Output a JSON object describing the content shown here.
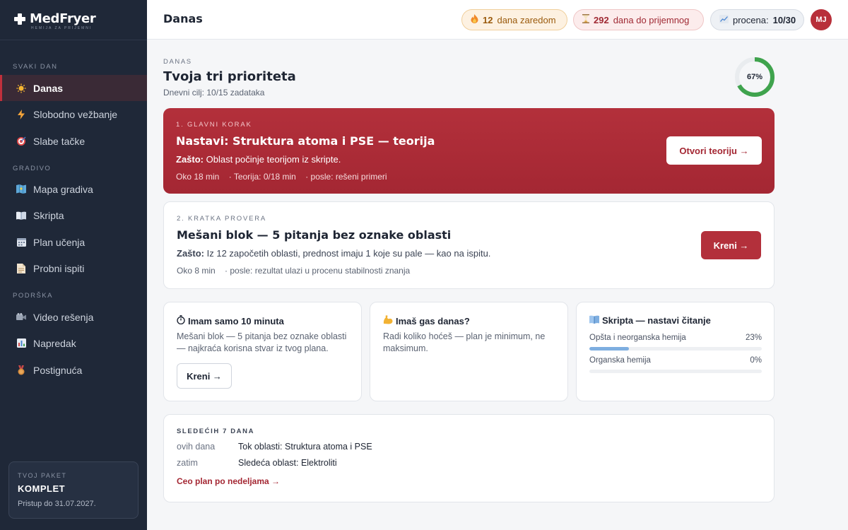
{
  "brand": {
    "name": "MedFryer",
    "tagline": "HEMIJA ZA PRIJEMNI"
  },
  "sidebar": {
    "sections": [
      {
        "label": "SVAKI DAN",
        "items": [
          {
            "label": "Danas",
            "icon": "sun-icon",
            "active": true
          },
          {
            "label": "Slobodno vežbanje",
            "icon": "lightning-icon"
          },
          {
            "label": "Slabe tačke",
            "icon": "target-icon"
          }
        ]
      },
      {
        "label": "GRADIVO",
        "items": [
          {
            "label": "Mapa gradiva",
            "icon": "map-icon"
          },
          {
            "label": "Skripta",
            "icon": "book-icon"
          },
          {
            "label": "Plan učenja",
            "icon": "calendar-icon"
          },
          {
            "label": "Probni ispiti",
            "icon": "document-icon"
          }
        ]
      },
      {
        "label": "PODRŠKA",
        "items": [
          {
            "label": "Video rešenja",
            "icon": "video-camera-icon"
          },
          {
            "label": "Napredak",
            "icon": "bar-chart-icon"
          },
          {
            "label": "Postignuća",
            "icon": "medal-icon"
          }
        ]
      }
    ],
    "plan": {
      "small_label": "TVOJ PAKET",
      "name": "KOMPLET",
      "access": "Pristup do 31.07.2027."
    }
  },
  "topbar": {
    "title": "Danas",
    "streak": {
      "value": "12",
      "label": "dana zaredom"
    },
    "days_left": {
      "value": "292",
      "label": "dana do prijemnog"
    },
    "estimate": {
      "label": "procena:",
      "value": "10/30"
    },
    "avatar": "MJ"
  },
  "main": {
    "kicker": "DANAS",
    "heading": "Tvoja tri prioriteta",
    "goal": "Dnevni cilj: 10/15 zadataka",
    "progress_percent": 67,
    "progress_label": "67%",
    "priority1": {
      "kicker": "1. GLAVNI KORAK",
      "title": "Nastavi: Struktura atoma i PSE — teorija",
      "why_label": "Zašto:",
      "why_text": "Oblast počinje teorijom iz skripte.",
      "meta": [
        "Oko 18 min",
        "· Teorija: 0/18 min",
        "· posle: rešeni primeri"
      ],
      "button": "Otvori teoriju →"
    },
    "priority2": {
      "kicker": "2. KRATKA PROVERA",
      "title": "Mešani blok — 5 pitanja bez oznake oblasti",
      "why_label": "Zašto:",
      "why_text": "Iz 12 započetih oblasti, prednost imaju 1 koje su pale — kao na ispitu.",
      "meta": [
        "Oko 8 min",
        "· posle: rezultat ulazi u procenu stabilnosti znanja"
      ],
      "button": "Kreni →"
    },
    "quick": {
      "title": "Imam samo 10 minuta",
      "icon": "stopwatch-icon",
      "text": "Mešani blok — 5 pitanja bez oznake oblasti — najkraća korisna stvar iz tvog plana.",
      "button": "Kreni →"
    },
    "gas": {
      "title": "Imaš gas danas?",
      "icon": "flexed-biceps-icon",
      "text": "Radi koliko hoćeš — plan je minimum, ne maksimum."
    },
    "script": {
      "title": "Skripta — nastavi čitanje",
      "icon": "book-icon",
      "rows": [
        {
          "name": "Opšta i neorganska hemija",
          "pct_label": "23%",
          "pct": 23
        },
        {
          "name": "Organska hemija",
          "pct_label": "0%",
          "pct": 0
        }
      ]
    },
    "week": {
      "kicker": "SLEDEĆIH 7 DANA",
      "rows": [
        {
          "when": "ovih dana",
          "what": "Tok oblasti: Struktura atoma i PSE"
        },
        {
          "when": "zatim",
          "what": "Sledeća oblast: Elektroliti"
        }
      ],
      "link": "Ceo plan po nedeljama →"
    }
  },
  "colors": {
    "accent": "#b3303b",
    "sidebar": "#1f2838",
    "progress": "#3fa34d"
  }
}
